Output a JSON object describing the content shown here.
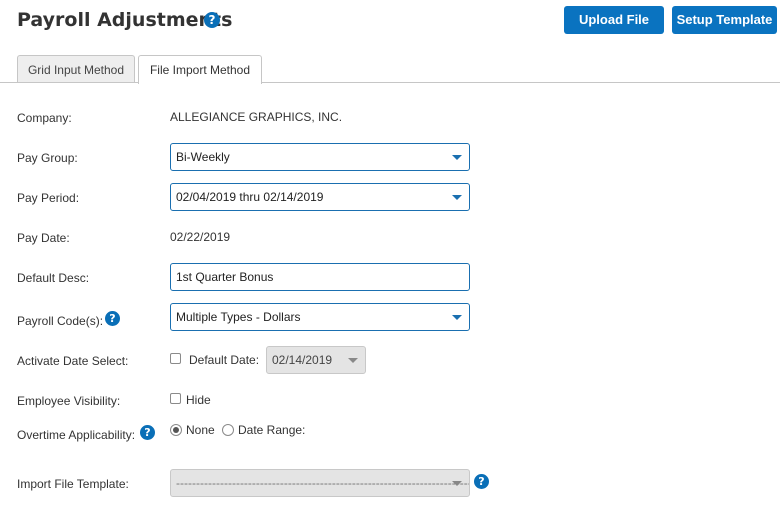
{
  "page": {
    "title": "Payroll Adjustments"
  },
  "header": {
    "upload_label": "Upload File",
    "setup_label": "Setup Template"
  },
  "tabs": [
    {
      "label": "Grid Input Method",
      "active": false
    },
    {
      "label": "File Import Method",
      "active": true
    }
  ],
  "form": {
    "company": {
      "label": "Company:",
      "value": "ALLEGIANCE GRAPHICS, INC."
    },
    "pay_group": {
      "label": "Pay Group:",
      "value": "Bi-Weekly"
    },
    "pay_period": {
      "label": "Pay Period:",
      "value": "02/04/2019 thru 02/14/2019"
    },
    "pay_date": {
      "label": "Pay Date:",
      "value": "02/22/2019"
    },
    "default_desc": {
      "label": "Default Desc:",
      "value": "1st Quarter Bonus"
    },
    "payroll_codes": {
      "label": "Payroll Code(s):",
      "value": "Multiple Types - Dollars"
    },
    "activate_date": {
      "label": "Activate Date Select:",
      "checkbox_label": "Default Date:",
      "checked": false,
      "date_value": "02/14/2019"
    },
    "employee_visibility": {
      "label": "Employee Visibility:",
      "checkbox_label": "Hide",
      "checked": false
    },
    "overtime": {
      "label": "Overtime Applicability:",
      "options": [
        "None",
        "Date Range:"
      ],
      "selected": "None"
    },
    "import_template": {
      "label": "Import File Template:",
      "value": "--------------------------------------------------------------------------"
    }
  },
  "colors": {
    "accent": "#0a73c0",
    "border": "#1a6fb0",
    "disabled_bg": "#e4e4e4"
  },
  "icons": {
    "help": "question-circle-icon",
    "dropdown": "caret-down-icon"
  }
}
